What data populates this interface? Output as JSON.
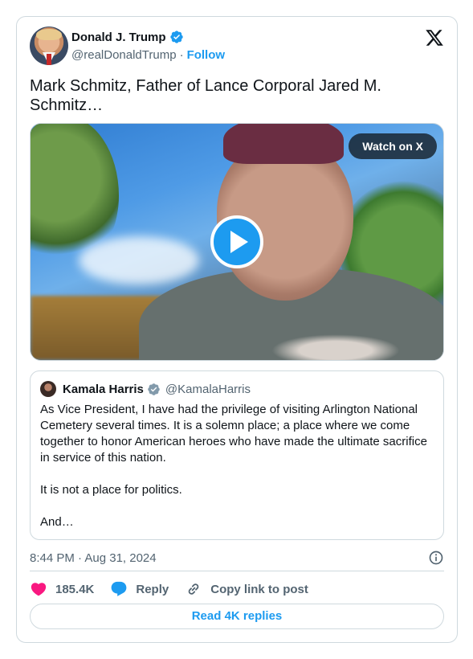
{
  "author": {
    "display_name": "Donald J. Trump",
    "handle": "@realDonaldTrump",
    "separator": "·",
    "follow_label": "Follow",
    "verified_color": "#1d9bf0"
  },
  "tweet": {
    "text": "Mark Schmitz, Father of Lance Corporal Jared M. Schmitz…"
  },
  "media": {
    "watch_label": "Watch on X",
    "play_icon": "play-icon"
  },
  "quote": {
    "display_name": "Kamala Harris",
    "handle": "@KamalaHarris",
    "verified_color": "#829aab",
    "paragraphs": [
      "As Vice President, I have had the privilege of visiting Arlington National Cemetery several times. It is a solemn place; a place where we come together to honor American heroes who have made the ultimate sacrifice in service of this nation.",
      "It is not a place for politics.",
      "And…"
    ]
  },
  "meta": {
    "timestamp": "8:44 PM · Aug 31, 2024"
  },
  "actions": {
    "like_count": "185.4K",
    "reply_label": "Reply",
    "copy_label": "Copy link to post"
  },
  "footer": {
    "read_replies_label": "Read 4K replies"
  },
  "colors": {
    "accent": "#1d9bf0",
    "like": "#f91880",
    "text": "#0f1419",
    "muted": "#536471",
    "border": "#cfd9de"
  }
}
